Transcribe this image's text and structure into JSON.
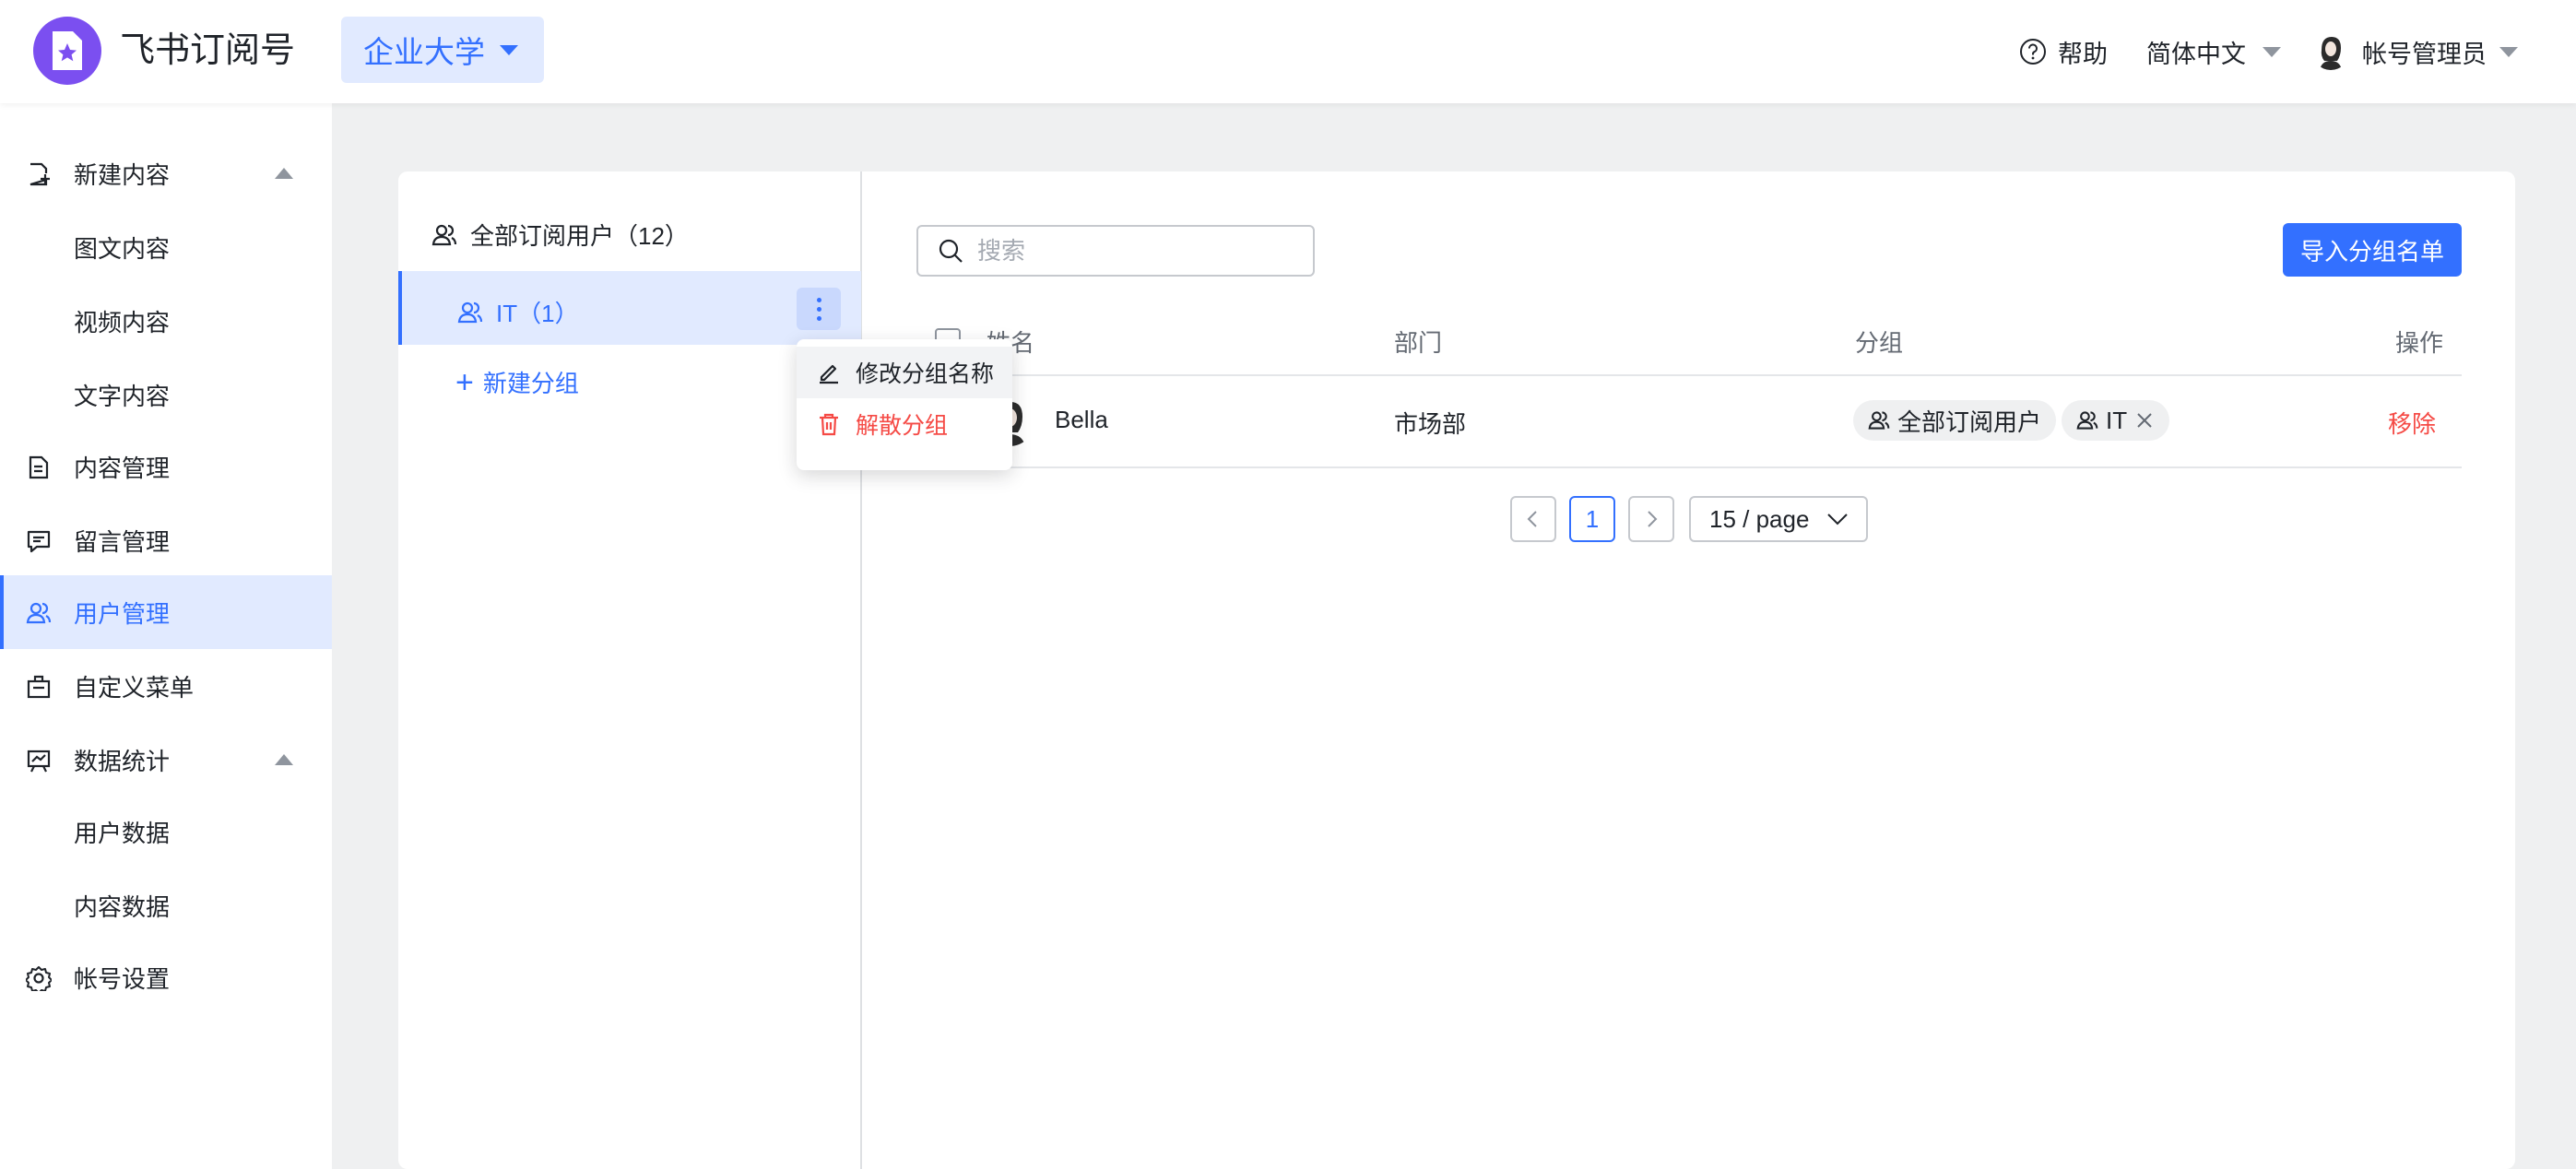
{
  "header": {
    "app_title": "飞书订阅号",
    "workspace": "企业大学",
    "help": "帮助",
    "language": "简体中文",
    "user_name": "帐号管理员"
  },
  "sidebar": {
    "items": [
      {
        "label": "新建内容",
        "icon": "file-add-icon",
        "expanded": true
      },
      {
        "label": "图文内容"
      },
      {
        "label": "视频内容"
      },
      {
        "label": "文字内容"
      },
      {
        "label": "内容管理",
        "icon": "document-icon"
      },
      {
        "label": "留言管理",
        "icon": "comment-icon"
      },
      {
        "label": "用户管理",
        "icon": "users-icon",
        "active": true
      },
      {
        "label": "自定义菜单",
        "icon": "menu-icon"
      },
      {
        "label": "数据统计",
        "icon": "chart-icon",
        "expanded": true
      },
      {
        "label": "用户数据"
      },
      {
        "label": "内容数据"
      },
      {
        "label": "帐号设置",
        "icon": "gear-icon"
      }
    ]
  },
  "groups": {
    "all_label": "全部订阅用户（12）",
    "it_label": "IT（1）",
    "new_group": "新建分组"
  },
  "menu": {
    "rename": "修改分组名称",
    "dissolve": "解散分组"
  },
  "search": {
    "placeholder": "搜索"
  },
  "import_button": "导入分组名单",
  "table": {
    "headers": {
      "name": "姓名",
      "department": "部门",
      "group": "分组",
      "action": "操作"
    },
    "rows": [
      {
        "name": "Bella",
        "department": "市场部",
        "tags": [
          "全部订阅用户",
          "IT"
        ],
        "action": "移除"
      }
    ]
  },
  "pagination": {
    "current_page": "1",
    "page_size": "15 / page"
  },
  "colors": {
    "accent": "#3370ff",
    "danger": "#f54a45",
    "brand": "#7b4ff0"
  }
}
